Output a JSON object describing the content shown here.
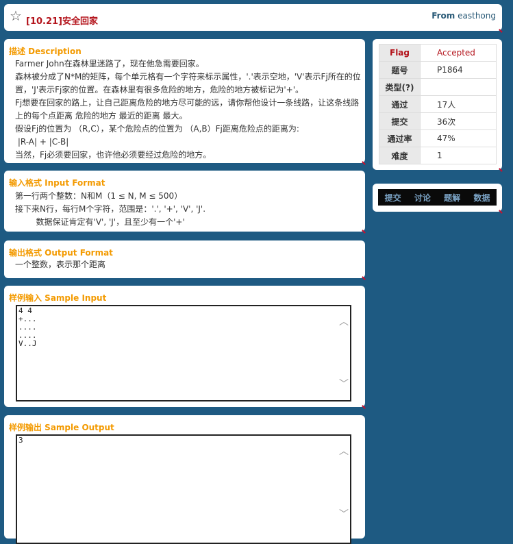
{
  "header": {
    "title": "[10.21]安全回家",
    "from_label": "From",
    "from_user": "easthong"
  },
  "description": {
    "heading": "描述 Description",
    "lines": [
      "Farmer John在森林里迷路了，现在他急需要回家。",
      "森林被分成了N*M的矩阵，每个单元格有一个字符来标示属性，'.'表示空地，'V'表示Fj所在的位",
      "置，'J'表示Fj家的位置。在森林里有很多危险的地方，危险的地方被标记为'+'。",
      "Fj想要在回家的路上，让自己距离危险的地方尽可能的远，请你帮他设计一条线路，让这条线路",
      "上的每个点距离 危险的地方 最近的距离 最大。",
      "假设Fj的位置为 （R,C），某个危险点的位置为 （A,B）Fj距离危险点的距离为:",
      " |R-A| + |C-B|",
      "当然，Fj必须要回家，也许他必须要经过危险的地方。"
    ]
  },
  "input_format": {
    "heading": "输入格式 Input Format",
    "lines": [
      "第一行两个整数：N和M（1 ≤  N,  M  ≤  500）",
      "接下来N行，每行M个字符，范围是：'.', '+', 'V', 'J'.",
      "        数据保证肯定有'V', 'J'，且至少有一个'+'"
    ]
  },
  "output_format": {
    "heading": "输出格式 Output Format",
    "lines": [
      "一个整数，表示那个距离"
    ]
  },
  "sample_input": {
    "heading": "样例输入 Sample Input",
    "text": "4 4\n+...\n....\n....\nV..J"
  },
  "sample_output": {
    "heading": "样例输出 Sample Output",
    "text": "3"
  },
  "info": {
    "rows": [
      {
        "key": "Flag",
        "value": "Accepted"
      },
      {
        "key": "题号",
        "value": "P1864"
      },
      {
        "key": "类型(?)",
        "value": ""
      },
      {
        "key": "通过",
        "value": "17人"
      },
      {
        "key": "提交",
        "value": "36次"
      },
      {
        "key": "通过率",
        "value": "47%"
      },
      {
        "key": "难度",
        "value": "1"
      }
    ]
  },
  "actions": [
    "提交",
    "讨论",
    "题解",
    "数据"
  ],
  "icons": {
    "favorite": "star-outline-icon",
    "scroll_up": "chevron-up-icon",
    "scroll_down": "chevron-down-icon"
  },
  "colors": {
    "background": "#1e5a82",
    "heading": "#f39a00",
    "title": "#b3121a",
    "accent_red": "#c8102e"
  }
}
